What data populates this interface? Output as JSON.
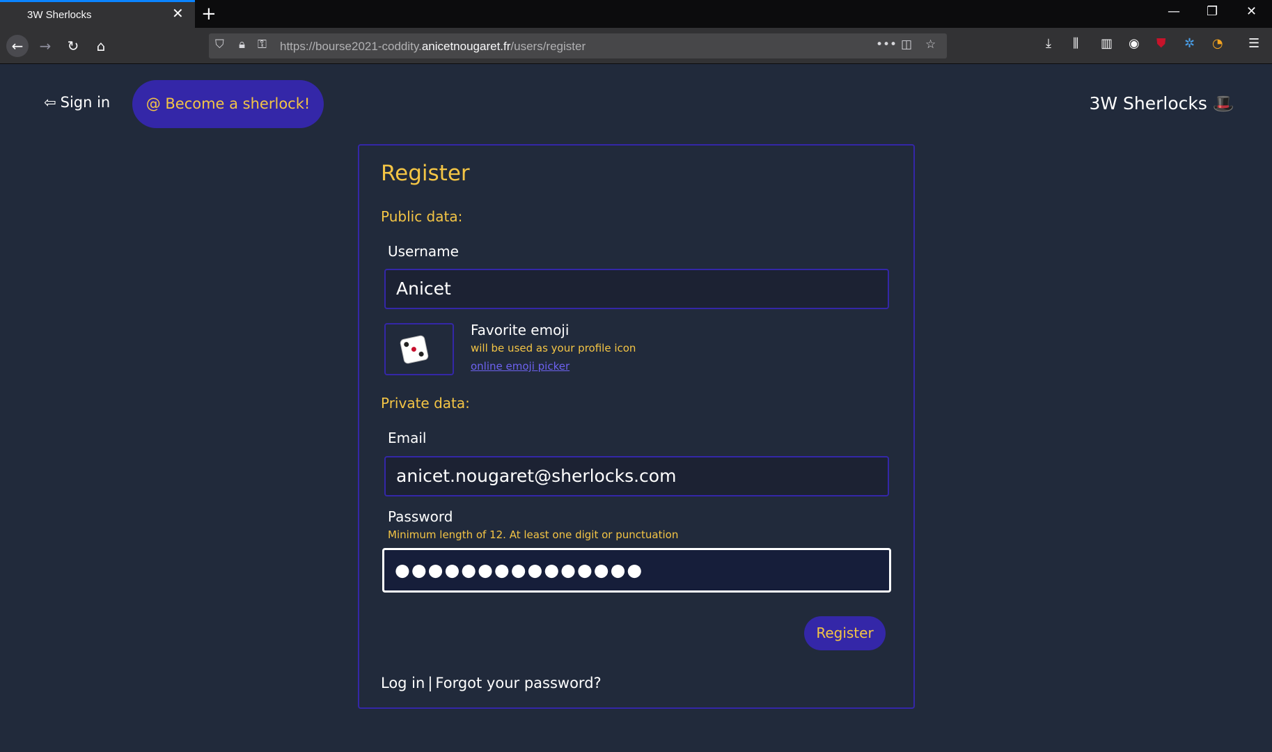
{
  "browser": {
    "tab_title": "3W Sherlocks",
    "url_prefix": "https://bourse2021-coddity.",
    "url_host": "anicetnougaret.fr",
    "url_path": "/users/register"
  },
  "header": {
    "signin_label": "Sign in",
    "become_label": "@ Become a sherlock!",
    "brand": "3W Sherlocks 🎩"
  },
  "form": {
    "title": "Register",
    "public_section": "Public data:",
    "username_label": "Username",
    "username_value": "Anicet",
    "emoji_title": "Favorite emoji",
    "emoji_subtitle": "will be used as your profile icon",
    "emoji_link": "online emoji picker",
    "emoji_icon": "die-icon",
    "private_section": "Private data:",
    "email_label": "Email",
    "email_value": "anicet.nougaret@sherlocks.com",
    "password_label": "Password",
    "password_hint": "Minimum length of 12. At least one digit or punctuation",
    "password_value": "●●●●●●●●●●●●●●●",
    "register_button": "Register",
    "login_link": "Log in",
    "separator": "|",
    "forgot_link": "Forgot your password?"
  },
  "colors": {
    "background": "#212a3b",
    "accent": "#3427a8",
    "highlight": "#f4c545"
  }
}
